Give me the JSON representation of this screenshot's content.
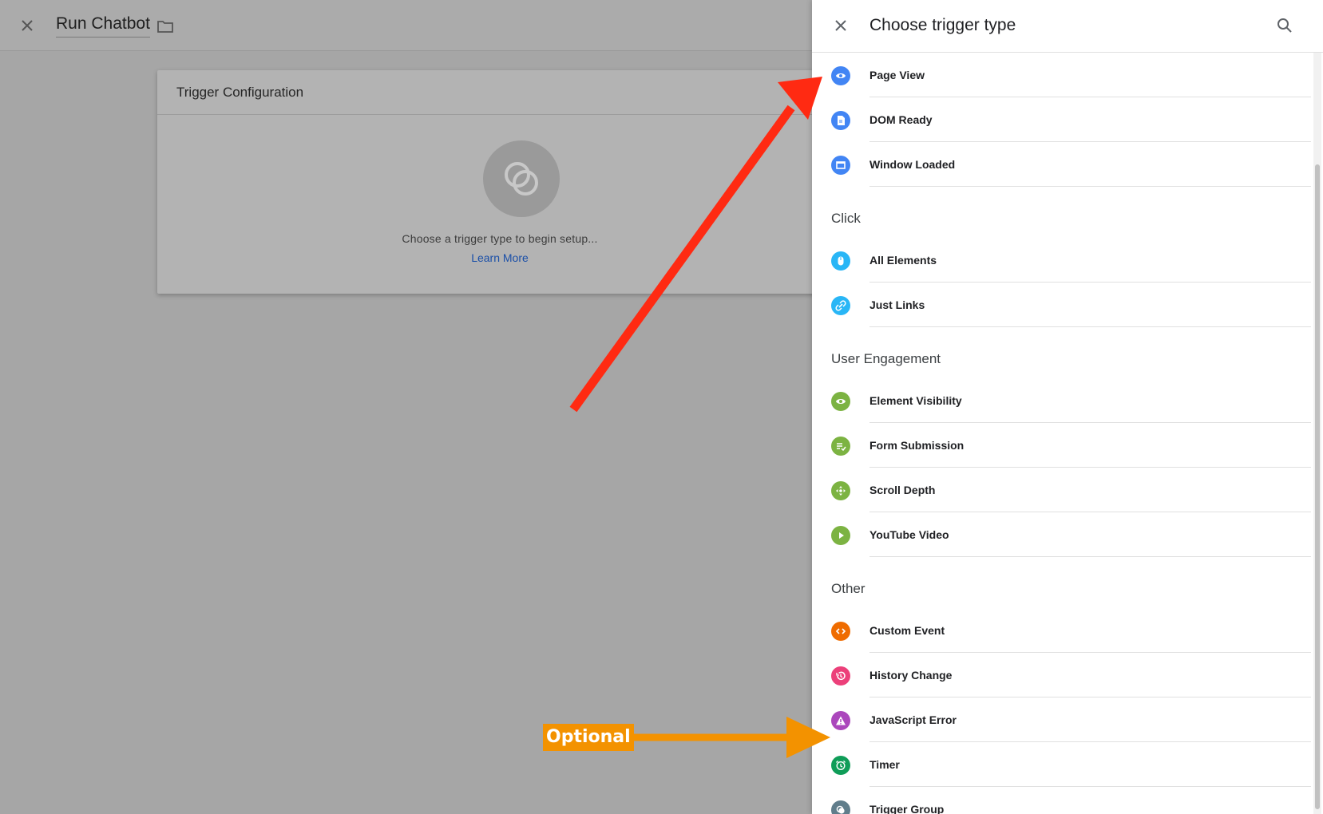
{
  "topbar": {
    "title": "Run Chatbot"
  },
  "card": {
    "header": "Trigger Configuration",
    "hint": "Choose a trigger type to begin setup...",
    "learn_more": "Learn More"
  },
  "panel": {
    "title": "Choose trigger type",
    "sections": [
      {
        "label": "",
        "items": [
          {
            "label": "Page View",
            "icon": "eye-icon",
            "color": "#4285f4"
          },
          {
            "label": "DOM Ready",
            "icon": "document-icon",
            "color": "#4285f4"
          },
          {
            "label": "Window Loaded",
            "icon": "window-icon",
            "color": "#4285f4"
          }
        ]
      },
      {
        "label": "Click",
        "items": [
          {
            "label": "All Elements",
            "icon": "mouse-icon",
            "color": "#29b6f6"
          },
          {
            "label": "Just Links",
            "icon": "link-icon",
            "color": "#29b6f6"
          }
        ]
      },
      {
        "label": "User Engagement",
        "items": [
          {
            "label": "Element Visibility",
            "icon": "eye-icon",
            "color": "#7cb342"
          },
          {
            "label": "Form Submission",
            "icon": "form-check-icon",
            "color": "#7cb342"
          },
          {
            "label": "Scroll Depth",
            "icon": "scroll-icon",
            "color": "#7cb342"
          },
          {
            "label": "YouTube Video",
            "icon": "play-icon",
            "color": "#7cb342"
          }
        ]
      },
      {
        "label": "Other",
        "items": [
          {
            "label": "Custom Event",
            "icon": "code-icon",
            "color": "#ef6c00"
          },
          {
            "label": "History Change",
            "icon": "history-icon",
            "color": "#ec407a"
          },
          {
            "label": "JavaScript Error",
            "icon": "warning-icon",
            "color": "#ab47bc"
          },
          {
            "label": "Timer",
            "icon": "alarm-icon",
            "color": "#0f9d58"
          },
          {
            "label": "Trigger Group",
            "icon": "trigger-group-icon",
            "color": "#607d8b"
          }
        ]
      }
    ]
  },
  "annotation": {
    "optional_label": "Optional",
    "red_arrow_color": "#ff2a12",
    "orange_arrow_color": "#f39200"
  }
}
